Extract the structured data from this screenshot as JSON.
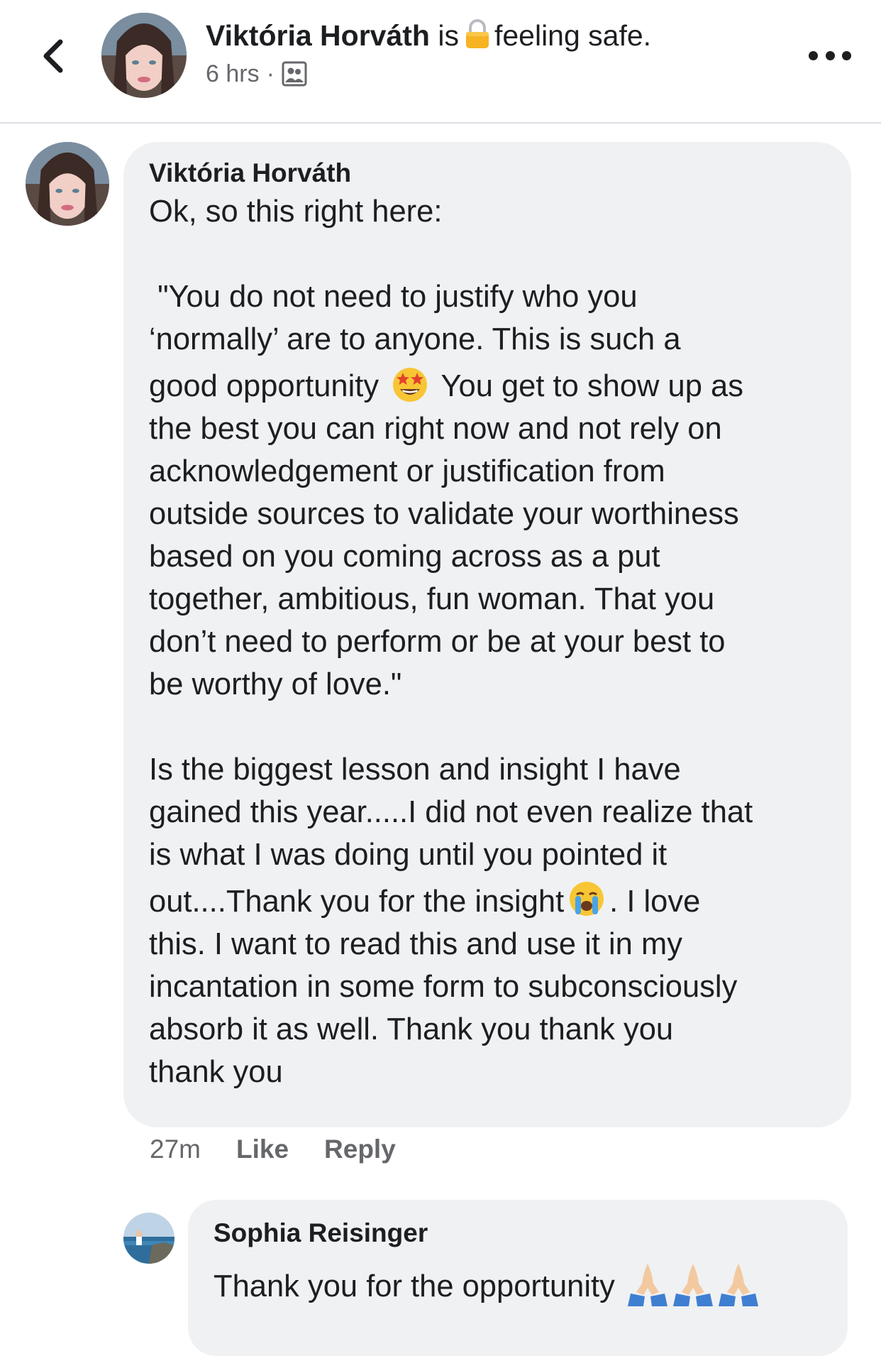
{
  "header": {
    "author_name": "Viktória Horváth",
    "verb": "is",
    "feeling_emoji": "lock-emoji",
    "feeling_text": "feeling safe.",
    "time": "6 hrs",
    "separator": "·",
    "audience_icon": "friends-audience-icon",
    "back_icon": "chevron-left-icon",
    "more_icon": "more-dots-icon"
  },
  "comment": {
    "author": "Viktória Horváth",
    "lines": {
      "l1": "Ok, so this right here:",
      "l2": " \"You do not need to justify who you",
      "l3": "‘normally’ are to anyone. This is such a",
      "l4a": "good opportunity",
      "l4b": "You get to show up as",
      "l5": "the best you can right now and not rely on",
      "l6": "acknowledgement or justification from",
      "l7": "outside sources to validate your worthiness",
      "l8": "based on you coming across as a put",
      "l9": "together, ambitious, fun woman. That you",
      "l10": "don’t need to perform or be at your best to",
      "l11": "be worthy of love.\"",
      "l12": "Is the biggest lesson and insight I have",
      "l13": "gained this year.....I did not even realize that",
      "l14": "is what I was doing until you pointed it",
      "l15a": "out....Thank you for the insight",
      "l15b": ". I love",
      "l16": "this. I want to read this and use it in my",
      "l17": "incantation in some form to subconsciously",
      "l18": "absorb it as well. Thank you thank you",
      "l19": "thank you"
    },
    "emojis": [
      "star-struck-emoji",
      "loudly-crying-emoji"
    ],
    "time": "27m",
    "like_label": "Like",
    "reply_label": "Reply"
  },
  "reply": {
    "author": "Sophia Reisinger",
    "text": "Thank you for the opportunity",
    "emojis": [
      "folded-hands-emoji",
      "folded-hands-emoji",
      "folded-hands-emoji"
    ]
  },
  "colors": {
    "bubble_bg": "#f0f1f3",
    "text": "#1c1e21",
    "secondary_text": "#65676b",
    "divider": "#dcdee3"
  }
}
